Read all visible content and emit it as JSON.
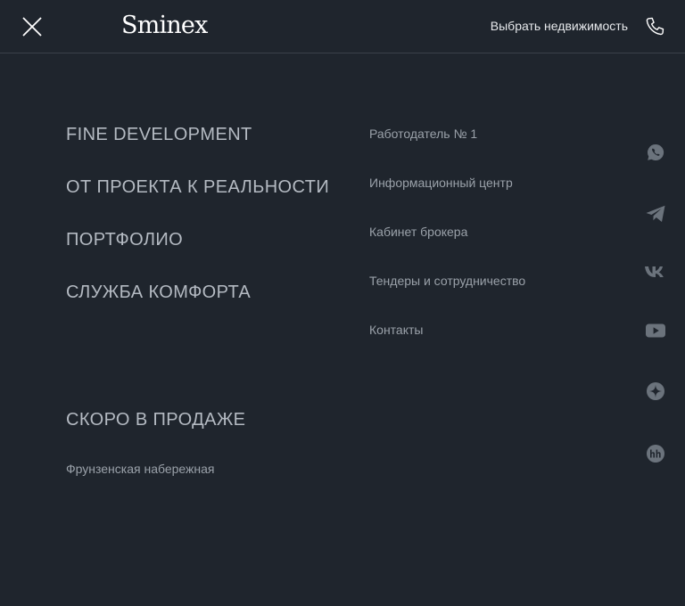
{
  "header": {
    "logo": "Sminex",
    "choose_property": "Выбрать недвижимость",
    "icons": {
      "close": "close-icon",
      "phone": "phone-icon"
    }
  },
  "main_menu": {
    "items": [
      {
        "label": "FINE DEVELOPMENT"
      },
      {
        "label": "ОТ ПРОЕКТА К РЕАЛЬНОСТИ"
      },
      {
        "label": "ПОРТФОЛИО"
      },
      {
        "label": "СЛУЖБА КОМФОРТА"
      }
    ]
  },
  "coming_soon": {
    "title": "СКОРО В ПРОДАЖЕ",
    "items": [
      {
        "label": "Фрунзенская набережная"
      }
    ]
  },
  "secondary_menu": {
    "items": [
      {
        "label": "Работодатель № 1"
      },
      {
        "label": "Информационный центр"
      },
      {
        "label": "Кабинет брокера"
      },
      {
        "label": "Тендеры и сотрудничество"
      },
      {
        "label": "Контакты"
      }
    ]
  },
  "social": [
    "whatsapp-icon",
    "telegram-icon",
    "vk-icon",
    "youtube-icon",
    "zen-icon",
    "hh-icon"
  ],
  "colors": {
    "background": "#1f252d",
    "divider": "#3a414a",
    "primary_text": "#b4bac2",
    "secondary_text": "#9aa1a9",
    "icon": "#6b737c"
  }
}
